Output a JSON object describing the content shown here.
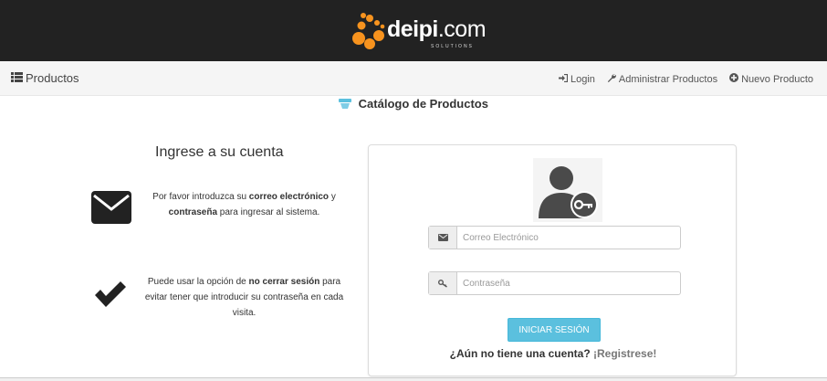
{
  "header": {
    "logo_text_bold": "deipi",
    "logo_text_light": ".com",
    "logo_subtext": "SOLUTIONS",
    "logo_color": "#f7931e"
  },
  "navbar": {
    "brand_label": "Productos",
    "links": [
      {
        "label": "Login",
        "icon": "sign-in-icon"
      },
      {
        "label": "Administrar Productos",
        "icon": "wrench-icon"
      },
      {
        "label": "Nuevo Producto",
        "icon": "plus-circle-icon"
      }
    ]
  },
  "page": {
    "catalog_title": "Catálogo de Productos"
  },
  "left": {
    "heading": "Ingrese a su cuenta",
    "info1": {
      "prefix": "Por favor introduzca su ",
      "bold1": "correo electrónico",
      "middle": " y ",
      "bold2": "contraseña",
      "suffix": " para ingresar al sistema."
    },
    "info2": {
      "prefix": "Puede usar la opción de ",
      "bold": "no cerrar sesión",
      "suffix": " para evitar tener que introducir su contraseña en cada visita."
    }
  },
  "login_form": {
    "email_placeholder": "Correo Electrónico",
    "password_placeholder": "Contraseña",
    "submit_label": "INICIAR SESIÓN",
    "register_question": "¿Aún no tiene una cuenta?",
    "register_link": "¡Registrese!",
    "button_color": "#5bc0de"
  }
}
